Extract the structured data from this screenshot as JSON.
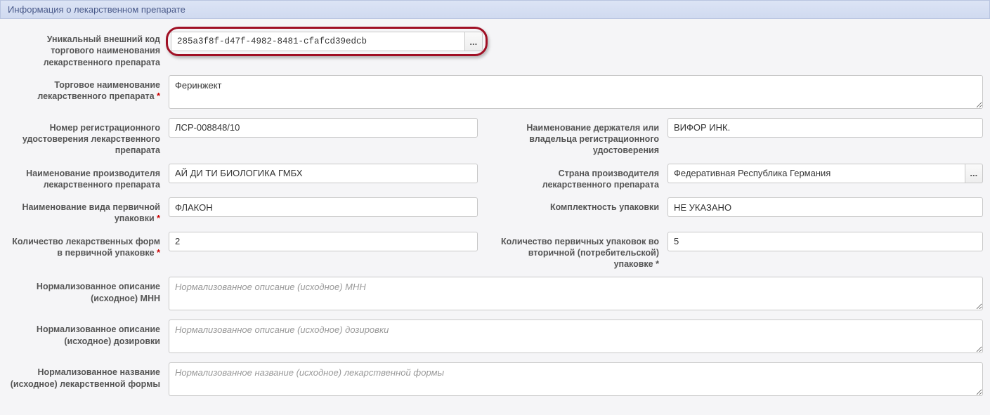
{
  "panel": {
    "title": "Информация о лекарственном препарате"
  },
  "labels": {
    "unique_code": "Уникальный внешний код торгового наименования лекарственного препарата",
    "trade_name": "Торговое наименование лекарственного препарата",
    "reg_cert_num": "Номер регистрационного удостоверения лекарственного препарата",
    "holder_name": "Наименование держателя или владельца регистрационного удостоверения",
    "manufacturer": "Наименование производителя лекарственного препарата",
    "manufacturer_country": "Страна производителя лекарственного препарата",
    "primary_pack_type": "Наименование вида первичной упаковки",
    "pack_completeness": "Комплектность упаковки",
    "forms_in_primary": "Количество лекарственных форм в первичной упаковке",
    "primary_in_secondary": "Количество первичных упаковок во вторичной (потребительской) упаковке",
    "norm_mnn": "Нормализованное описание (исходное) МНН",
    "norm_dosage": "Нормализованное описание (исходное) дозировки",
    "norm_form": "Нормализованное название (исходное) лекарственной формы"
  },
  "values": {
    "unique_code": "285a3f8f-d47f-4982-8481-cfafcd39edcb",
    "trade_name": "Феринжект",
    "reg_cert_num": "ЛСР-008848/10",
    "holder_name": "ВИФОР ИНК.",
    "manufacturer": "АЙ ДИ ТИ БИОЛОГИКА ГМБХ",
    "manufacturer_country": "Федеративная Республика Германия",
    "primary_pack_type": "ФЛАКОН",
    "pack_completeness": "НЕ УКАЗАНО",
    "forms_in_primary": "2",
    "primary_in_secondary": "5",
    "norm_mnn": "",
    "norm_dosage": "",
    "norm_form": ""
  },
  "placeholders": {
    "norm_mnn": "Нормализованное описание (исходное) МНН",
    "norm_dosage": "Нормализованное описание (исходное) дозировки",
    "norm_form": "Нормализованное название (исходное) лекарственной формы"
  },
  "buttons": {
    "ellipsis": "..."
  }
}
